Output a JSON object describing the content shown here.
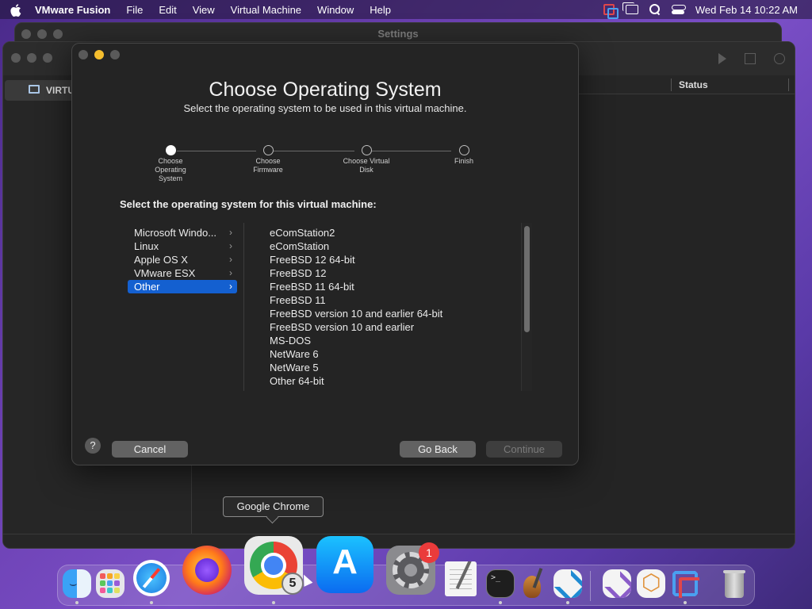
{
  "menubar": {
    "app_name": "VMware Fusion",
    "items": [
      "File",
      "Edit",
      "View",
      "Virtual Machine",
      "Window",
      "Help"
    ],
    "clock": "Wed Feb 14  10:22 AM",
    "icons": [
      "apple-icon",
      "vmware-status-icon",
      "screen-mirroring-icon",
      "spotlight-search-icon",
      "control-center-icon"
    ]
  },
  "settings_window": {
    "title": "Settings"
  },
  "library_window": {
    "sidebar_selected": "VIRTU",
    "column_status": "Status"
  },
  "dialog": {
    "title": "Choose Operating System",
    "subtitle": "Select the operating system to be used in this virtual machine.",
    "steps": [
      {
        "label": "Choose Operating System",
        "active": true
      },
      {
        "label": "Choose Firmware",
        "active": false
      },
      {
        "label": "Choose Virtual Disk",
        "active": false
      },
      {
        "label": "Finish",
        "active": false
      }
    ],
    "select_label": "Select the operating system for this virtual machine:",
    "categories": [
      {
        "label": "Microsoft Windo...",
        "selected": false
      },
      {
        "label": "Linux",
        "selected": false
      },
      {
        "label": "Apple OS X",
        "selected": false
      },
      {
        "label": "VMware ESX",
        "selected": false
      },
      {
        "label": "Other",
        "selected": true
      }
    ],
    "os_items": [
      "eComStation2",
      "eComStation",
      "FreeBSD 12 64-bit",
      "FreeBSD 12",
      "FreeBSD 11 64-bit",
      "FreeBSD 11",
      "FreeBSD version 10 and earlier 64-bit",
      "FreeBSD version 10 and earlier",
      "MS-DOS",
      "NetWare 6",
      "NetWare 5",
      "Other 64-bit"
    ],
    "help_label": "?",
    "buttons": {
      "cancel": "Cancel",
      "go_back": "Go Back",
      "continue": "Continue"
    }
  },
  "tooltip": "Google Chrome",
  "dock": {
    "items": [
      "Finder",
      "Launchpad",
      "Safari",
      "Firefox",
      "Google Chrome",
      "App Store",
      "System Settings",
      "TextEdit",
      "Terminal",
      "Instruments",
      "Visual Studio Code",
      "Visual Studio",
      "Hexagon App",
      "VMware Fusion",
      "Trash"
    ],
    "chrome_badge": "5",
    "settings_badge": "1"
  },
  "colors": {
    "accent": "#1460d0",
    "dialog_bg": "#242424",
    "badge_red": "#ea3b3b"
  }
}
